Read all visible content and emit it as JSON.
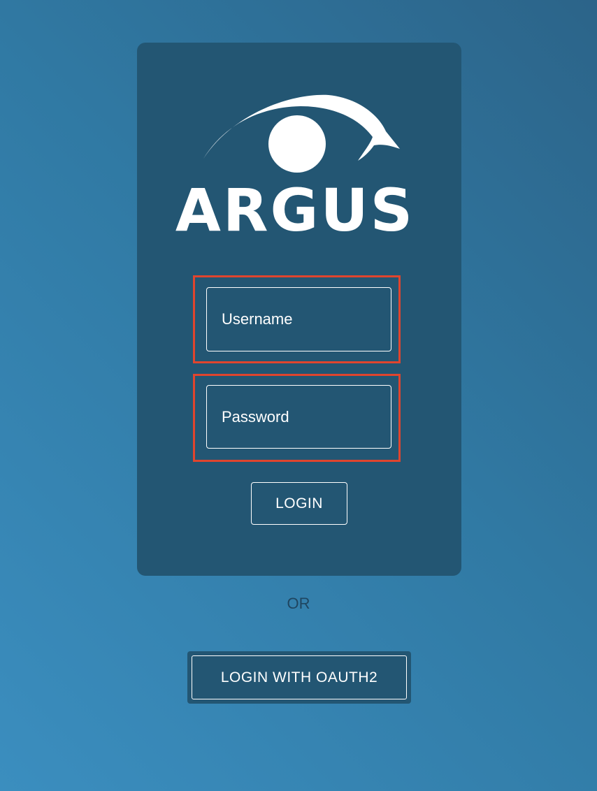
{
  "logo": {
    "name": "argus-logo",
    "wordmark": "ARGUS"
  },
  "form": {
    "username_placeholder": "Username",
    "username_value": "",
    "password_placeholder": "Password",
    "password_value": "",
    "login_label": "LOGIN"
  },
  "separator": {
    "or_label": "OR"
  },
  "oauth": {
    "button_label": "LOGIN WITH OAUTH2"
  },
  "colors": {
    "background": "#3079a3",
    "card": "#235673",
    "highlight": "#e0452e",
    "text": "#ffffff"
  }
}
